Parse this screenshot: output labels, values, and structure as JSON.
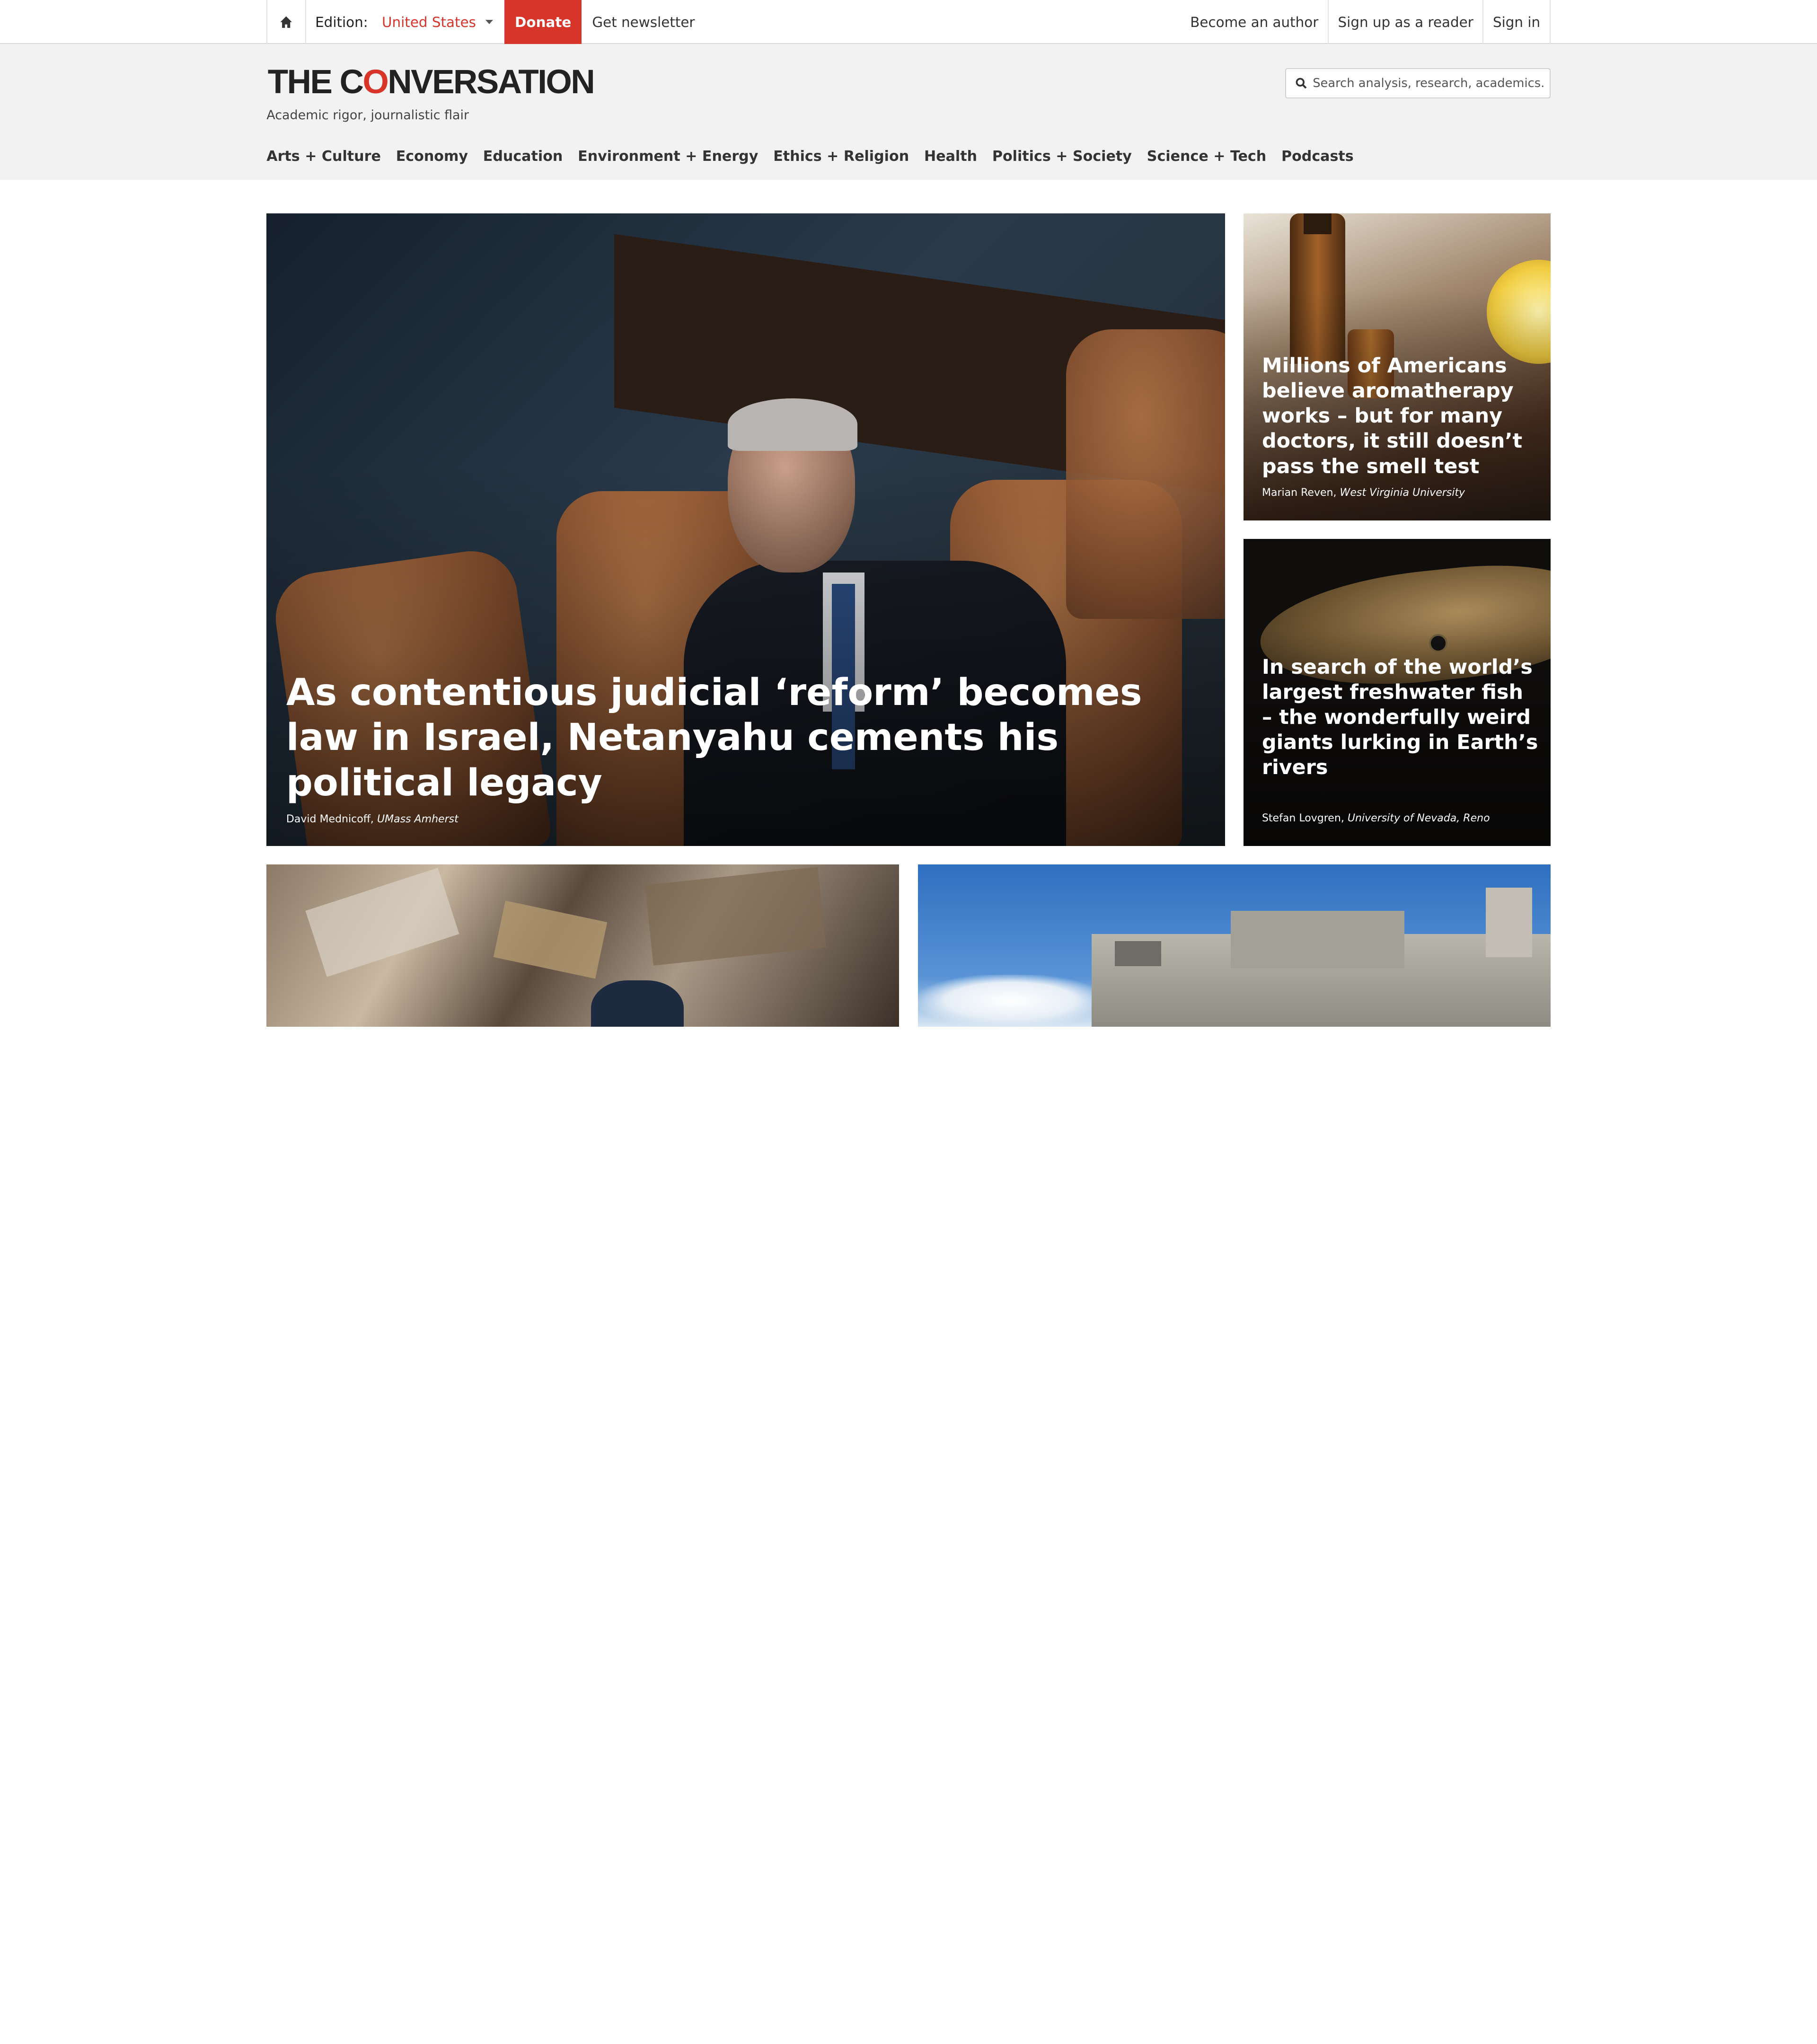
{
  "topbar": {
    "edition_label": "Edition:",
    "edition_value": "United States",
    "donate": "Donate",
    "newsletter": "Get newsletter",
    "become_author": "Become an author",
    "sign_up": "Sign up as a reader",
    "sign_in": "Sign in"
  },
  "brand": {
    "logo_left": "THE C",
    "logo_bubble": "O",
    "logo_right": "NVERSATION",
    "tagline": "Academic rigor, journalistic flair",
    "accent": "#d8352a"
  },
  "search": {
    "placeholder": "Search analysis, research, academics..."
  },
  "nav": [
    "Arts + Culture",
    "Economy",
    "Education",
    "Environment + Energy",
    "Ethics + Religion",
    "Health",
    "Politics + Society",
    "Science + Tech",
    "Podcasts"
  ],
  "stories": {
    "hero": {
      "headline": "As contentious judicial ‘reform’ becomes law in Israel, Netanyahu cements his political legacy",
      "author": "David Mednicoff,",
      "institution": "UMass Amherst"
    },
    "side1": {
      "headline": "Millions of Americans believe aromatherapy works – but for many doctors, it still doesn’t pass the smell test",
      "author": "Marian Reven,",
      "institution": "West Virginia University"
    },
    "side2": {
      "headline": "In search of the world’s largest freshwater fish – the wonderfully weird giants lurking in Earth’s rivers",
      "author": "Stefan Lovgren,",
      "institution": "University of Nevada, Reno"
    }
  }
}
